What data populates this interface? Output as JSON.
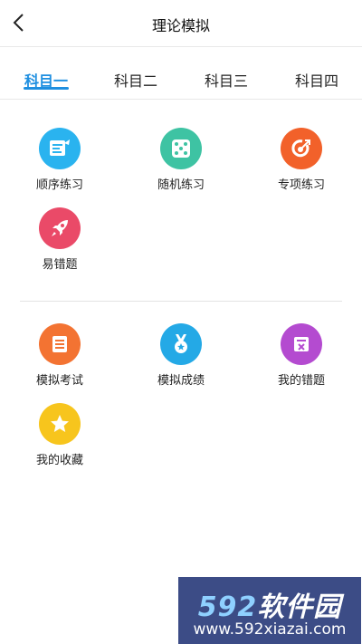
{
  "header": {
    "title": "理论模拟"
  },
  "tabs": [
    {
      "label": "科目一",
      "active": true
    },
    {
      "label": "科目二",
      "active": false
    },
    {
      "label": "科目三",
      "active": false
    },
    {
      "label": "科目四",
      "active": false
    }
  ],
  "section1": [
    {
      "label": "顺序练习",
      "icon": "list-icon",
      "color": "#2ab3ef"
    },
    {
      "label": "随机练习",
      "icon": "dice-icon",
      "color": "#3ec3a3"
    },
    {
      "label": "专项练习",
      "icon": "target-icon",
      "color": "#f2612a"
    },
    {
      "label": "易错题",
      "icon": "rocket-icon",
      "color": "#ea4a68"
    }
  ],
  "section2": [
    {
      "label": "模拟考试",
      "icon": "book-icon",
      "color": "#f37332"
    },
    {
      "label": "模拟成绩",
      "icon": "medal-icon",
      "color": "#24a9e6"
    },
    {
      "label": "我的错题",
      "icon": "wrong-icon",
      "color": "#b44bd0"
    },
    {
      "label": "我的收藏",
      "icon": "star-icon",
      "color": "#f7c51d"
    }
  ],
  "watermark": {
    "brand_num": "592",
    "brand_text": "软件园",
    "url": "www.592xiazai.com"
  }
}
